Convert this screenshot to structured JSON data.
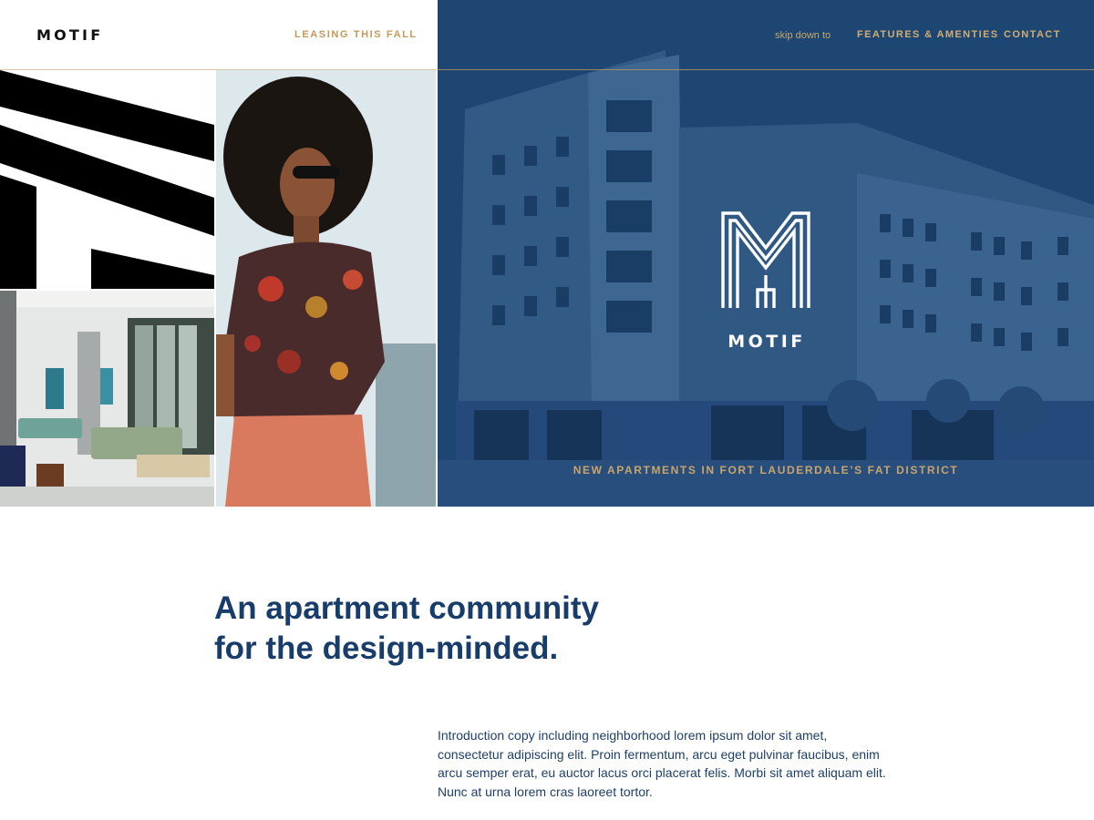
{
  "header": {
    "brand": "MOTIF",
    "leasing_link": "LEASING THIS FALL",
    "skip_label": "skip down to",
    "nav": {
      "features": "FEATURES & AMENTIES",
      "contact": "CONTACT"
    }
  },
  "hero": {
    "logo_wordmark": "MOTIF",
    "tagline": "NEW APARTMENTS IN FORT LAUDERDALE’S FAT DISTRICT"
  },
  "intro": {
    "headline_line1": "An apartment community",
    "headline_line2": "for the design-minded.",
    "body": "Introduction copy including neighborhood lorem ipsum dolor sit amet, consectetur adipiscing elit. Proin fermentum, arcu eget pulvinar faucibus, enim arcu semper erat, eu auctor lacus orci placerat felis. Morbi sit amet aliquam elit. Nunc at urna lorem cras laoreet tortor."
  },
  "colors": {
    "brand_navy": "#1d4672",
    "accent_gold": "#c9a46a",
    "text_navy": "#183d6a"
  },
  "icons": {
    "hero_logo": "motif-m-monogram-icon",
    "pattern_tile": "black-diagonal-stripes"
  }
}
